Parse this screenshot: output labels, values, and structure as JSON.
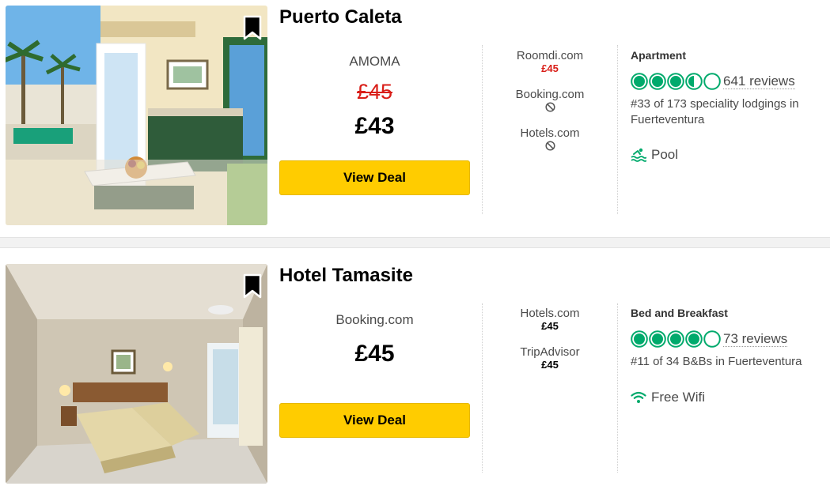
{
  "listings": [
    {
      "name": "Puerto Caleta",
      "provider": "AMOMA",
      "old_price": "£45",
      "price": "£43",
      "deal_label": "View Deal",
      "offers": [
        {
          "site": "Roomdi.com",
          "price": "£45"
        },
        {
          "site": "Booking.com"
        },
        {
          "site": "Hotels.com"
        }
      ],
      "type": "Apartment",
      "rating": 3.5,
      "reviews": "641 reviews",
      "rank": "#33 of 173 speciality lodgings in Fuerteventura",
      "amenity": "Pool",
      "amenity_icon": "pool-icon"
    },
    {
      "name": "Hotel Tamasite",
      "provider": "Booking.com",
      "price": "£45",
      "deal_label": "View Deal",
      "offers": [
        {
          "site": "Hotels.com",
          "price": "£45"
        },
        {
          "site": "TripAdvisor",
          "price": "£45"
        }
      ],
      "type": "Bed and Breakfast",
      "rating": 4,
      "reviews": "73 reviews",
      "rank": "#11 of 34 B&Bs in Fuerteventura",
      "amenity": "Free Wifi",
      "amenity_icon": "wifi-icon"
    }
  ],
  "colors": {
    "deal_button": "#ffcc00",
    "rating_green": "#00aa6c",
    "strike_red": "#d91e18"
  }
}
